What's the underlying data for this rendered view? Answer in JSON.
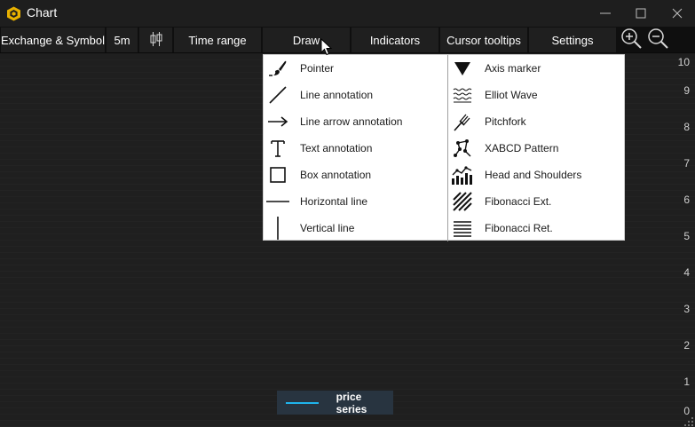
{
  "window": {
    "title": "Chart"
  },
  "toolbar": {
    "exchange_symbol": "Exchange & Symbol",
    "interval": "5m",
    "time_range": "Time range",
    "draw": "Draw",
    "indicators": "Indicators",
    "cursor_tooltips": "Cursor tooltips",
    "settings": "Settings"
  },
  "draw_menu": {
    "left": [
      {
        "label": "Pointer",
        "icon": "pointer-brush-icon"
      },
      {
        "label": "Line annotation",
        "icon": "line-icon"
      },
      {
        "label": "Line arrow annotation",
        "icon": "arrow-icon"
      },
      {
        "label": "Text annotation",
        "icon": "text-icon"
      },
      {
        "label": "Box annotation",
        "icon": "box-icon"
      },
      {
        "label": "Horizontal line",
        "icon": "horizontal-line-icon"
      },
      {
        "label": "Vertical line",
        "icon": "vertical-line-icon"
      }
    ],
    "right": [
      {
        "label": "Axis marker",
        "icon": "axis-marker-icon"
      },
      {
        "label": "Elliot Wave",
        "icon": "elliot-wave-icon"
      },
      {
        "label": "Pitchfork",
        "icon": "pitchfork-icon"
      },
      {
        "label": "XABCD Pattern",
        "icon": "xabcd-pattern-icon"
      },
      {
        "label": "Head and Shoulders",
        "icon": "head-and-shoulders-icon"
      },
      {
        "label": "Fibonacci Ext.",
        "icon": "fibonacci-ext-icon"
      },
      {
        "label": "Fibonacci Ret.",
        "icon": "fibonacci-ret-icon"
      }
    ]
  },
  "y_axis": {
    "ticks": [
      "10",
      "9",
      "8",
      "7",
      "6",
      "5",
      "4",
      "3",
      "2",
      "1",
      "0"
    ]
  },
  "legend": {
    "series_name": "price series",
    "color": "#1fb4ec"
  },
  "colors": {
    "background": "#1e1e1e",
    "toolbar_button": "#1f1f1f",
    "menu_bg": "#ffffff",
    "accent_icon": "#f2c200"
  }
}
